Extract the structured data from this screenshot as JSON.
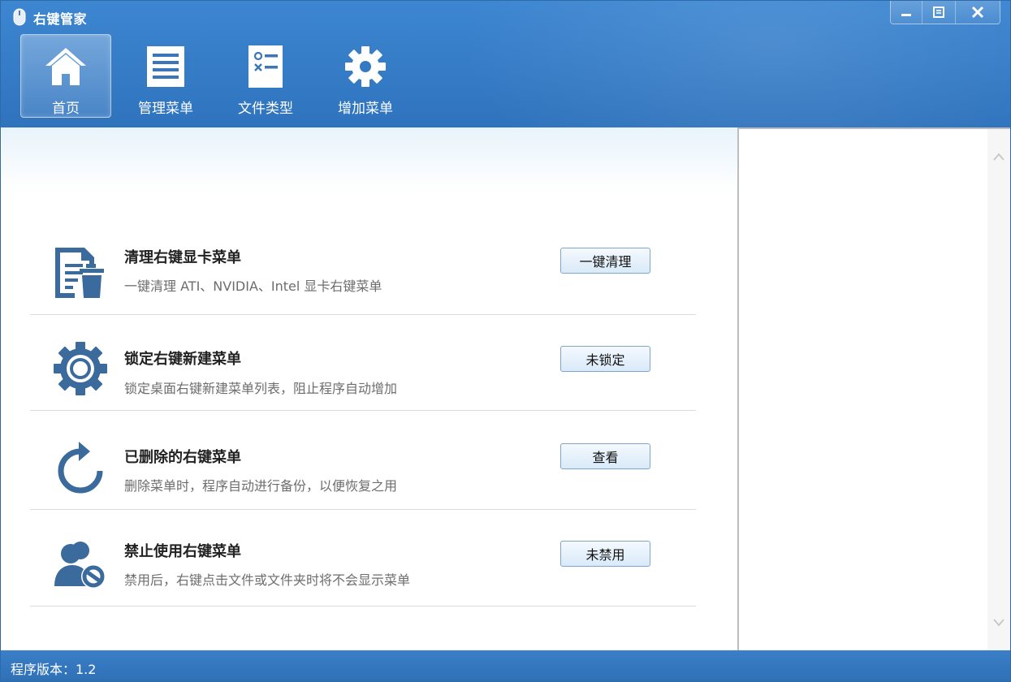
{
  "app": {
    "title": "右键管家"
  },
  "window_controls": [
    "minimize",
    "restore",
    "close"
  ],
  "nav": {
    "items": [
      {
        "label": "首页",
        "icon": "home-icon",
        "active": true
      },
      {
        "label": "管理菜单",
        "icon": "list-icon",
        "active": false
      },
      {
        "label": "文件类型",
        "icon": "file-type-icon",
        "active": false
      },
      {
        "label": "增加菜单",
        "icon": "gear-icon",
        "active": false
      }
    ]
  },
  "rows": [
    {
      "title": "清理右键显卡菜单",
      "desc": "一键清理 ATI、NVIDIA、Intel 显卡右键菜单",
      "button": "一键清理",
      "icon": "clean-document-icon"
    },
    {
      "title": "锁定右键新建菜单",
      "desc": "锁定桌面右键新建菜单列表，阻止程序自动增加",
      "button": "未锁定",
      "icon": "gear-icon"
    },
    {
      "title": "已删除的右键菜单",
      "desc": "删除菜单时，程序自动进行备份，以便恢复之用",
      "button": "查看",
      "icon": "restore-arrow-icon"
    },
    {
      "title": "禁止使用右键菜单",
      "desc": "禁用后，右键点击文件或文件夹时将不会显示菜单",
      "button": "未禁用",
      "icon": "user-disabled-icon"
    }
  ],
  "status": {
    "version": "程序版本：1.2"
  },
  "colors": {
    "accent": "#2f73bd",
    "icon": "#3a6b9c",
    "button_border": "#7fa7cc"
  }
}
